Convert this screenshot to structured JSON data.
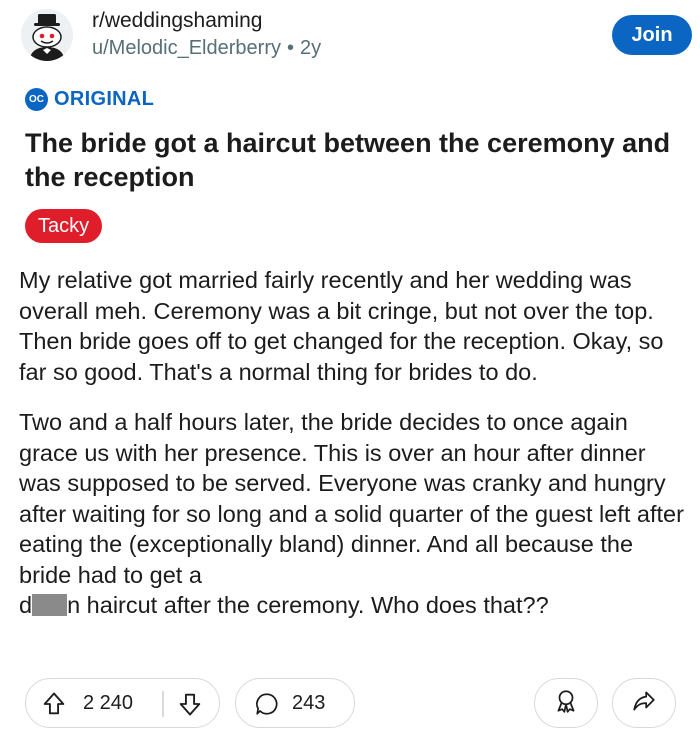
{
  "header": {
    "subreddit": "r/weddingshaming",
    "username": "u/Melodic_Elderberry",
    "separator": "•",
    "age": "2y",
    "join_label": "Join"
  },
  "oc": {
    "badge": "OC",
    "label": "ORIGINAL"
  },
  "post": {
    "title": "The bride got a haircut between the ceremony and the reception",
    "flair": "Tacky",
    "paragraph1": "My relative got married fairly recently and her wedding was overall meh. Ceremony was a bit cringe, but not over the top. Then bride goes off to get changed for the reception. Okay, so far so good. That's a normal thing for brides to do.",
    "paragraph2_main": "Two and a half hours later, the bride decides to once again grace us with her presence. This is over an hour after dinner was supposed to be served. Everyone was cranky and hungry after waiting for so long and a solid quarter of the guest left after eating the (exceptionally bland) dinner. And all because the bride had to get a",
    "paragraph2_redacted_start": "d",
    "paragraph2_redacted_end": "n haircut after the ceremony. Who does that??"
  },
  "actions": {
    "upvotes": "2 240",
    "comments": "243"
  },
  "icons": {
    "upvote": "upvote-arrow-icon",
    "downvote": "downvote-arrow-icon",
    "comment": "comment-bubble-icon",
    "save": "award-icon",
    "share": "share-arrow-icon",
    "avatar": "subreddit-avatar-icon"
  },
  "colors": {
    "accent": "#0a66c2",
    "flair_bg": "#e01e2b",
    "muted_text": "#576f76",
    "border": "#d7dadc"
  }
}
